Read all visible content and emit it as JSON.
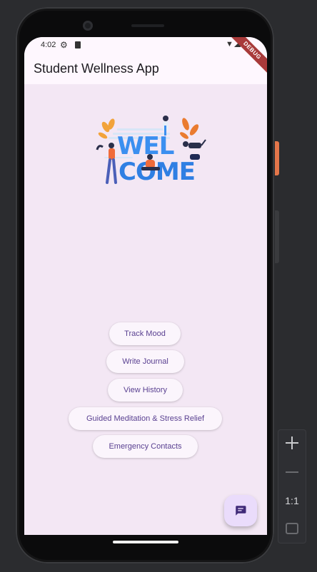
{
  "status_bar": {
    "time": "4:02"
  },
  "app_bar": {
    "title": "Student Wellness App"
  },
  "debug_banner": "DEBUG",
  "welcome_art": {
    "word_line1": "WEL",
    "word_line2": "COME"
  },
  "buttons": [
    {
      "label": "Track Mood"
    },
    {
      "label": "Write Journal"
    },
    {
      "label": "View History"
    },
    {
      "label": "Guided Meditation & Stress Relief"
    },
    {
      "label": "Emergency Contacts"
    }
  ],
  "fab": {
    "icon": "chat-icon"
  },
  "emulator_controls": {
    "zoom_ratio": "1:1"
  },
  "colors": {
    "background": "#f3e7f4",
    "app_bar": "#fef7fe",
    "button_text": "#5a4191",
    "fab": "#eadcfb"
  }
}
